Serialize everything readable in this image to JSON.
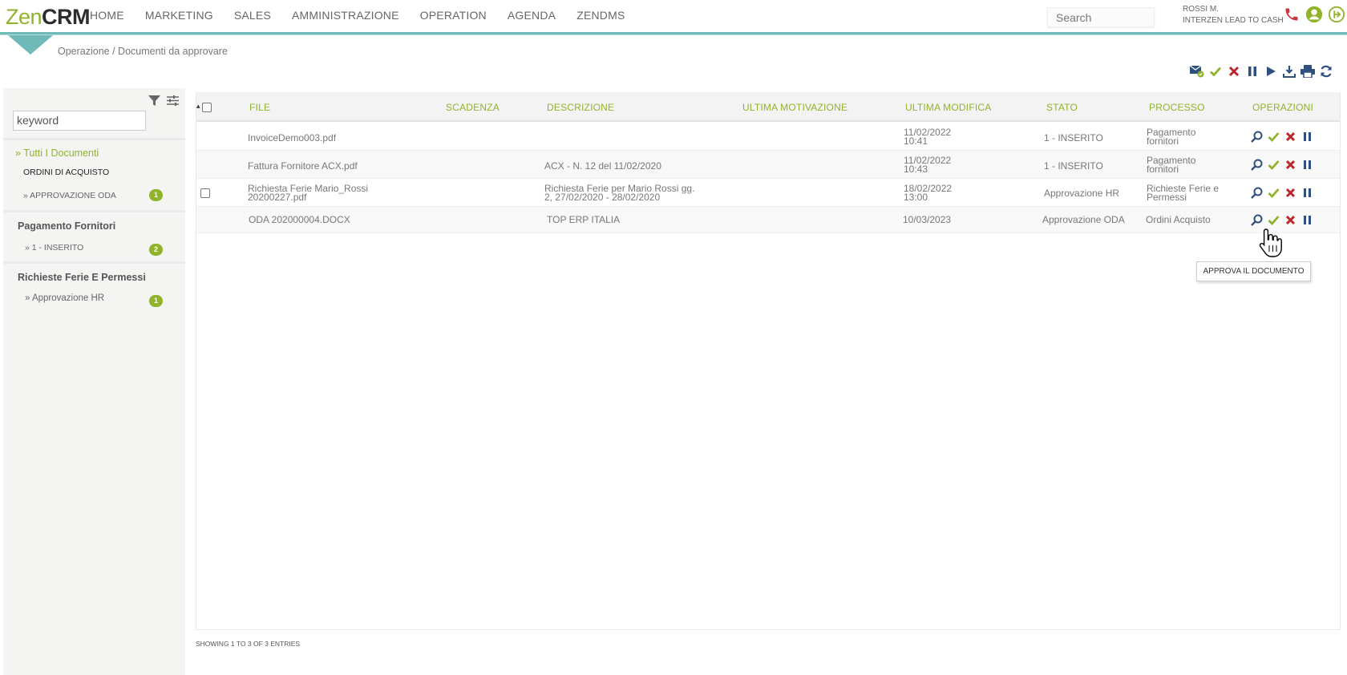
{
  "brand": {
    "part1": "Zen",
    "part2": "CRM"
  },
  "nav": [
    "HOME",
    "MARKETING",
    "SALES",
    "AMMINISTRAZIONE",
    "OPERATION",
    "AGENDA",
    "ZENDMS"
  ],
  "search": {
    "placeholder": "Search"
  },
  "user": {
    "name": "ROSSI M.",
    "company": "INTERZEN LEAD TO CASH"
  },
  "breadcrumb": "Operazione / Documenti da approvare",
  "colors": {
    "accent": "#8fb32b",
    "teal": "#6fb9b9",
    "reject": "#b8262b",
    "navy": "#2f4f7f"
  },
  "toolbar_icons": [
    "mail-check-icon",
    "check-icon",
    "close-icon",
    "pause-icon",
    "play-icon",
    "download-icon",
    "print-icon",
    "refresh-icon"
  ],
  "sidebar": {
    "keyword_placeholder": "keyword",
    "all_docs": "» Tutti I Documenti",
    "groups": [
      {
        "title": "ORDINI DI ACQUISTO",
        "items": [
          {
            "label": "» APPROVAZIONE ODA",
            "count": "1"
          }
        ]
      },
      {
        "title": "Pagamento Fornitori",
        "items": [
          {
            "label": "» 1 - INSERITO",
            "count": "2"
          }
        ]
      },
      {
        "title": "Richieste Ferie E Permessi",
        "items": [
          {
            "label": "» Approvazione HR",
            "count": "1"
          }
        ]
      }
    ]
  },
  "table": {
    "sort_indicator": "▴",
    "columns": [
      "FILE",
      "SCADENZA",
      "DESCRIZIONE",
      "ULTIMA MOTIVAZIONE",
      "ULTIMA MODIFICA",
      "STATO",
      "PROCESSO",
      "OPERAZIONI"
    ],
    "rows": [
      {
        "file": [
          "InvoiceDemo003.pdf"
        ],
        "scadenza": "",
        "descrizione": [
          ""
        ],
        "motivazione": "",
        "modifica": [
          "11/02/2022",
          "10:41"
        ],
        "stato": "1 - INSERITO",
        "processo": [
          "Pagamento",
          "fornitori"
        ],
        "checkbox": false
      },
      {
        "file": [
          "Fattura Fornitore ACX.pdf"
        ],
        "scadenza": "",
        "descrizione": [
          "ACX - N. 12 del 11/02/2020"
        ],
        "motivazione": "",
        "modifica": [
          "11/02/2022",
          "10:43"
        ],
        "stato": "1 - INSERITO",
        "processo": [
          "Pagamento",
          "fornitori"
        ],
        "checkbox": false
      },
      {
        "file": [
          "Richiesta Ferie Mario_Rossi",
          "20200227.pdf"
        ],
        "scadenza": "",
        "descrizione": [
          "Richiesta Ferie per Mario Rossi gg.",
          "2, 27/02/2020 - 28/02/2020"
        ],
        "motivazione": "",
        "modifica": [
          "18/02/2022",
          "13:00"
        ],
        "stato": "Approvazione HR",
        "processo": [
          "Richieste Ferie e",
          "Permessi"
        ],
        "checkbox": true
      },
      {
        "file": [
          "ODA 202000004.DOCX"
        ],
        "scadenza": "",
        "descrizione": [
          "TOP ERP ITALIA"
        ],
        "motivazione": "",
        "modifica": [
          "10/03/2023"
        ],
        "stato": "Approvazione ODA",
        "processo": [
          "Ordini Acquisto"
        ],
        "checkbox": false
      }
    ]
  },
  "tooltip": "APPROVA IL DOCUMENTO",
  "footer": "SHOWING 1 TO 3 OF 3 ENTRIES"
}
